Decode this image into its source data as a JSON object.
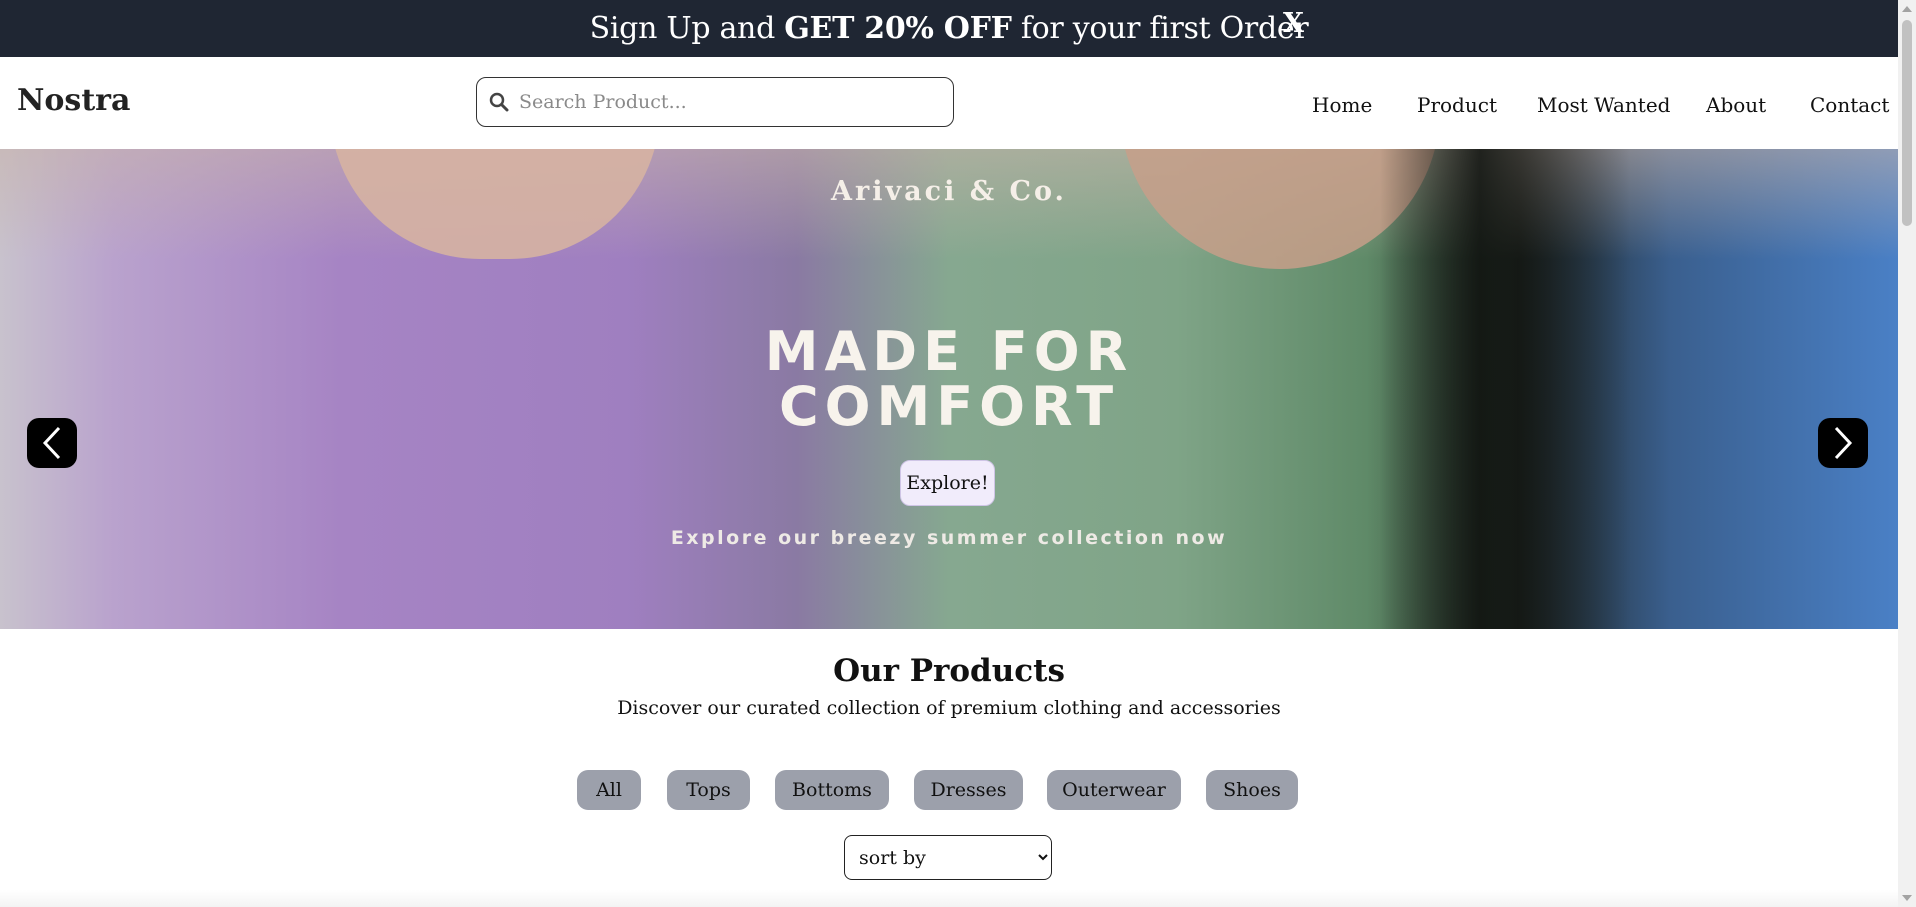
{
  "announcement": {
    "prefix": "Sign Up and ",
    "highlight": "GET 20% OFF",
    "suffix": " for your first Order",
    "close_label": "X"
  },
  "header": {
    "logo": "Nostra",
    "search": {
      "placeholder": "Search Product...",
      "value": ""
    },
    "menu": [
      "Home",
      "Product",
      "Most Wanted",
      "About",
      "Contact"
    ]
  },
  "hero": {
    "brand": "Arivaci & Co.",
    "headline_line1": "MADE FOR",
    "headline_line2": "COMFORT",
    "cta_label": "Explore!",
    "subtext": "Explore our breezy summer collection now",
    "prev_icon": "chevron-left-icon",
    "next_icon": "chevron-right-icon"
  },
  "products": {
    "title": "Our Products",
    "subtitle": "Discover our curated collection of premium clothing and accessories",
    "filters": [
      "All",
      "Tops",
      "Bottoms",
      "Dresses",
      "Outerwear",
      "Shoes"
    ],
    "sort": {
      "selected": "sort by"
    }
  },
  "colors": {
    "announcement_bg": "#1f2633",
    "chip_bg": "#9ca0ab",
    "cta_bg": "#f1ecfb"
  }
}
